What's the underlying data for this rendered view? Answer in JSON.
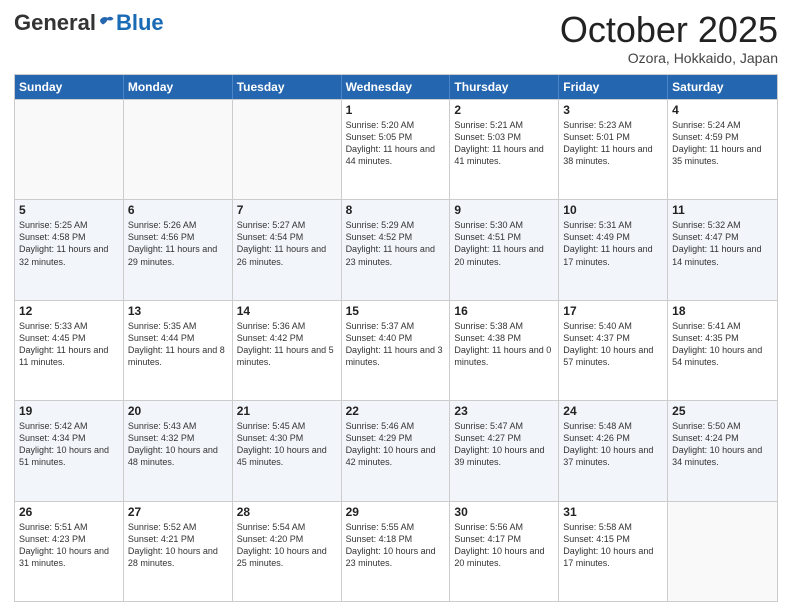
{
  "header": {
    "logo_general": "General",
    "logo_blue": "Blue",
    "month": "October 2025",
    "location": "Ozora, Hokkaido, Japan"
  },
  "calendar": {
    "days_of_week": [
      "Sunday",
      "Monday",
      "Tuesday",
      "Wednesday",
      "Thursday",
      "Friday",
      "Saturday"
    ],
    "rows": [
      [
        {
          "day": "",
          "sunrise": "",
          "sunset": "",
          "daylight": ""
        },
        {
          "day": "",
          "sunrise": "",
          "sunset": "",
          "daylight": ""
        },
        {
          "day": "",
          "sunrise": "",
          "sunset": "",
          "daylight": ""
        },
        {
          "day": "1",
          "sunrise": "Sunrise: 5:20 AM",
          "sunset": "Sunset: 5:05 PM",
          "daylight": "Daylight: 11 hours and 44 minutes."
        },
        {
          "day": "2",
          "sunrise": "Sunrise: 5:21 AM",
          "sunset": "Sunset: 5:03 PM",
          "daylight": "Daylight: 11 hours and 41 minutes."
        },
        {
          "day": "3",
          "sunrise": "Sunrise: 5:23 AM",
          "sunset": "Sunset: 5:01 PM",
          "daylight": "Daylight: 11 hours and 38 minutes."
        },
        {
          "day": "4",
          "sunrise": "Sunrise: 5:24 AM",
          "sunset": "Sunset: 4:59 PM",
          "daylight": "Daylight: 11 hours and 35 minutes."
        }
      ],
      [
        {
          "day": "5",
          "sunrise": "Sunrise: 5:25 AM",
          "sunset": "Sunset: 4:58 PM",
          "daylight": "Daylight: 11 hours and 32 minutes."
        },
        {
          "day": "6",
          "sunrise": "Sunrise: 5:26 AM",
          "sunset": "Sunset: 4:56 PM",
          "daylight": "Daylight: 11 hours and 29 minutes."
        },
        {
          "day": "7",
          "sunrise": "Sunrise: 5:27 AM",
          "sunset": "Sunset: 4:54 PM",
          "daylight": "Daylight: 11 hours and 26 minutes."
        },
        {
          "day": "8",
          "sunrise": "Sunrise: 5:29 AM",
          "sunset": "Sunset: 4:52 PM",
          "daylight": "Daylight: 11 hours and 23 minutes."
        },
        {
          "day": "9",
          "sunrise": "Sunrise: 5:30 AM",
          "sunset": "Sunset: 4:51 PM",
          "daylight": "Daylight: 11 hours and 20 minutes."
        },
        {
          "day": "10",
          "sunrise": "Sunrise: 5:31 AM",
          "sunset": "Sunset: 4:49 PM",
          "daylight": "Daylight: 11 hours and 17 minutes."
        },
        {
          "day": "11",
          "sunrise": "Sunrise: 5:32 AM",
          "sunset": "Sunset: 4:47 PM",
          "daylight": "Daylight: 11 hours and 14 minutes."
        }
      ],
      [
        {
          "day": "12",
          "sunrise": "Sunrise: 5:33 AM",
          "sunset": "Sunset: 4:45 PM",
          "daylight": "Daylight: 11 hours and 11 minutes."
        },
        {
          "day": "13",
          "sunrise": "Sunrise: 5:35 AM",
          "sunset": "Sunset: 4:44 PM",
          "daylight": "Daylight: 11 hours and 8 minutes."
        },
        {
          "day": "14",
          "sunrise": "Sunrise: 5:36 AM",
          "sunset": "Sunset: 4:42 PM",
          "daylight": "Daylight: 11 hours and 5 minutes."
        },
        {
          "day": "15",
          "sunrise": "Sunrise: 5:37 AM",
          "sunset": "Sunset: 4:40 PM",
          "daylight": "Daylight: 11 hours and 3 minutes."
        },
        {
          "day": "16",
          "sunrise": "Sunrise: 5:38 AM",
          "sunset": "Sunset: 4:38 PM",
          "daylight": "Daylight: 11 hours and 0 minutes."
        },
        {
          "day": "17",
          "sunrise": "Sunrise: 5:40 AM",
          "sunset": "Sunset: 4:37 PM",
          "daylight": "Daylight: 10 hours and 57 minutes."
        },
        {
          "day": "18",
          "sunrise": "Sunrise: 5:41 AM",
          "sunset": "Sunset: 4:35 PM",
          "daylight": "Daylight: 10 hours and 54 minutes."
        }
      ],
      [
        {
          "day": "19",
          "sunrise": "Sunrise: 5:42 AM",
          "sunset": "Sunset: 4:34 PM",
          "daylight": "Daylight: 10 hours and 51 minutes."
        },
        {
          "day": "20",
          "sunrise": "Sunrise: 5:43 AM",
          "sunset": "Sunset: 4:32 PM",
          "daylight": "Daylight: 10 hours and 48 minutes."
        },
        {
          "day": "21",
          "sunrise": "Sunrise: 5:45 AM",
          "sunset": "Sunset: 4:30 PM",
          "daylight": "Daylight: 10 hours and 45 minutes."
        },
        {
          "day": "22",
          "sunrise": "Sunrise: 5:46 AM",
          "sunset": "Sunset: 4:29 PM",
          "daylight": "Daylight: 10 hours and 42 minutes."
        },
        {
          "day": "23",
          "sunrise": "Sunrise: 5:47 AM",
          "sunset": "Sunset: 4:27 PM",
          "daylight": "Daylight: 10 hours and 39 minutes."
        },
        {
          "day": "24",
          "sunrise": "Sunrise: 5:48 AM",
          "sunset": "Sunset: 4:26 PM",
          "daylight": "Daylight: 10 hours and 37 minutes."
        },
        {
          "day": "25",
          "sunrise": "Sunrise: 5:50 AM",
          "sunset": "Sunset: 4:24 PM",
          "daylight": "Daylight: 10 hours and 34 minutes."
        }
      ],
      [
        {
          "day": "26",
          "sunrise": "Sunrise: 5:51 AM",
          "sunset": "Sunset: 4:23 PM",
          "daylight": "Daylight: 10 hours and 31 minutes."
        },
        {
          "day": "27",
          "sunrise": "Sunrise: 5:52 AM",
          "sunset": "Sunset: 4:21 PM",
          "daylight": "Daylight: 10 hours and 28 minutes."
        },
        {
          "day": "28",
          "sunrise": "Sunrise: 5:54 AM",
          "sunset": "Sunset: 4:20 PM",
          "daylight": "Daylight: 10 hours and 25 minutes."
        },
        {
          "day": "29",
          "sunrise": "Sunrise: 5:55 AM",
          "sunset": "Sunset: 4:18 PM",
          "daylight": "Daylight: 10 hours and 23 minutes."
        },
        {
          "day": "30",
          "sunrise": "Sunrise: 5:56 AM",
          "sunset": "Sunset: 4:17 PM",
          "daylight": "Daylight: 10 hours and 20 minutes."
        },
        {
          "day": "31",
          "sunrise": "Sunrise: 5:58 AM",
          "sunset": "Sunset: 4:15 PM",
          "daylight": "Daylight: 10 hours and 17 minutes."
        },
        {
          "day": "",
          "sunrise": "",
          "sunset": "",
          "daylight": ""
        }
      ]
    ]
  }
}
